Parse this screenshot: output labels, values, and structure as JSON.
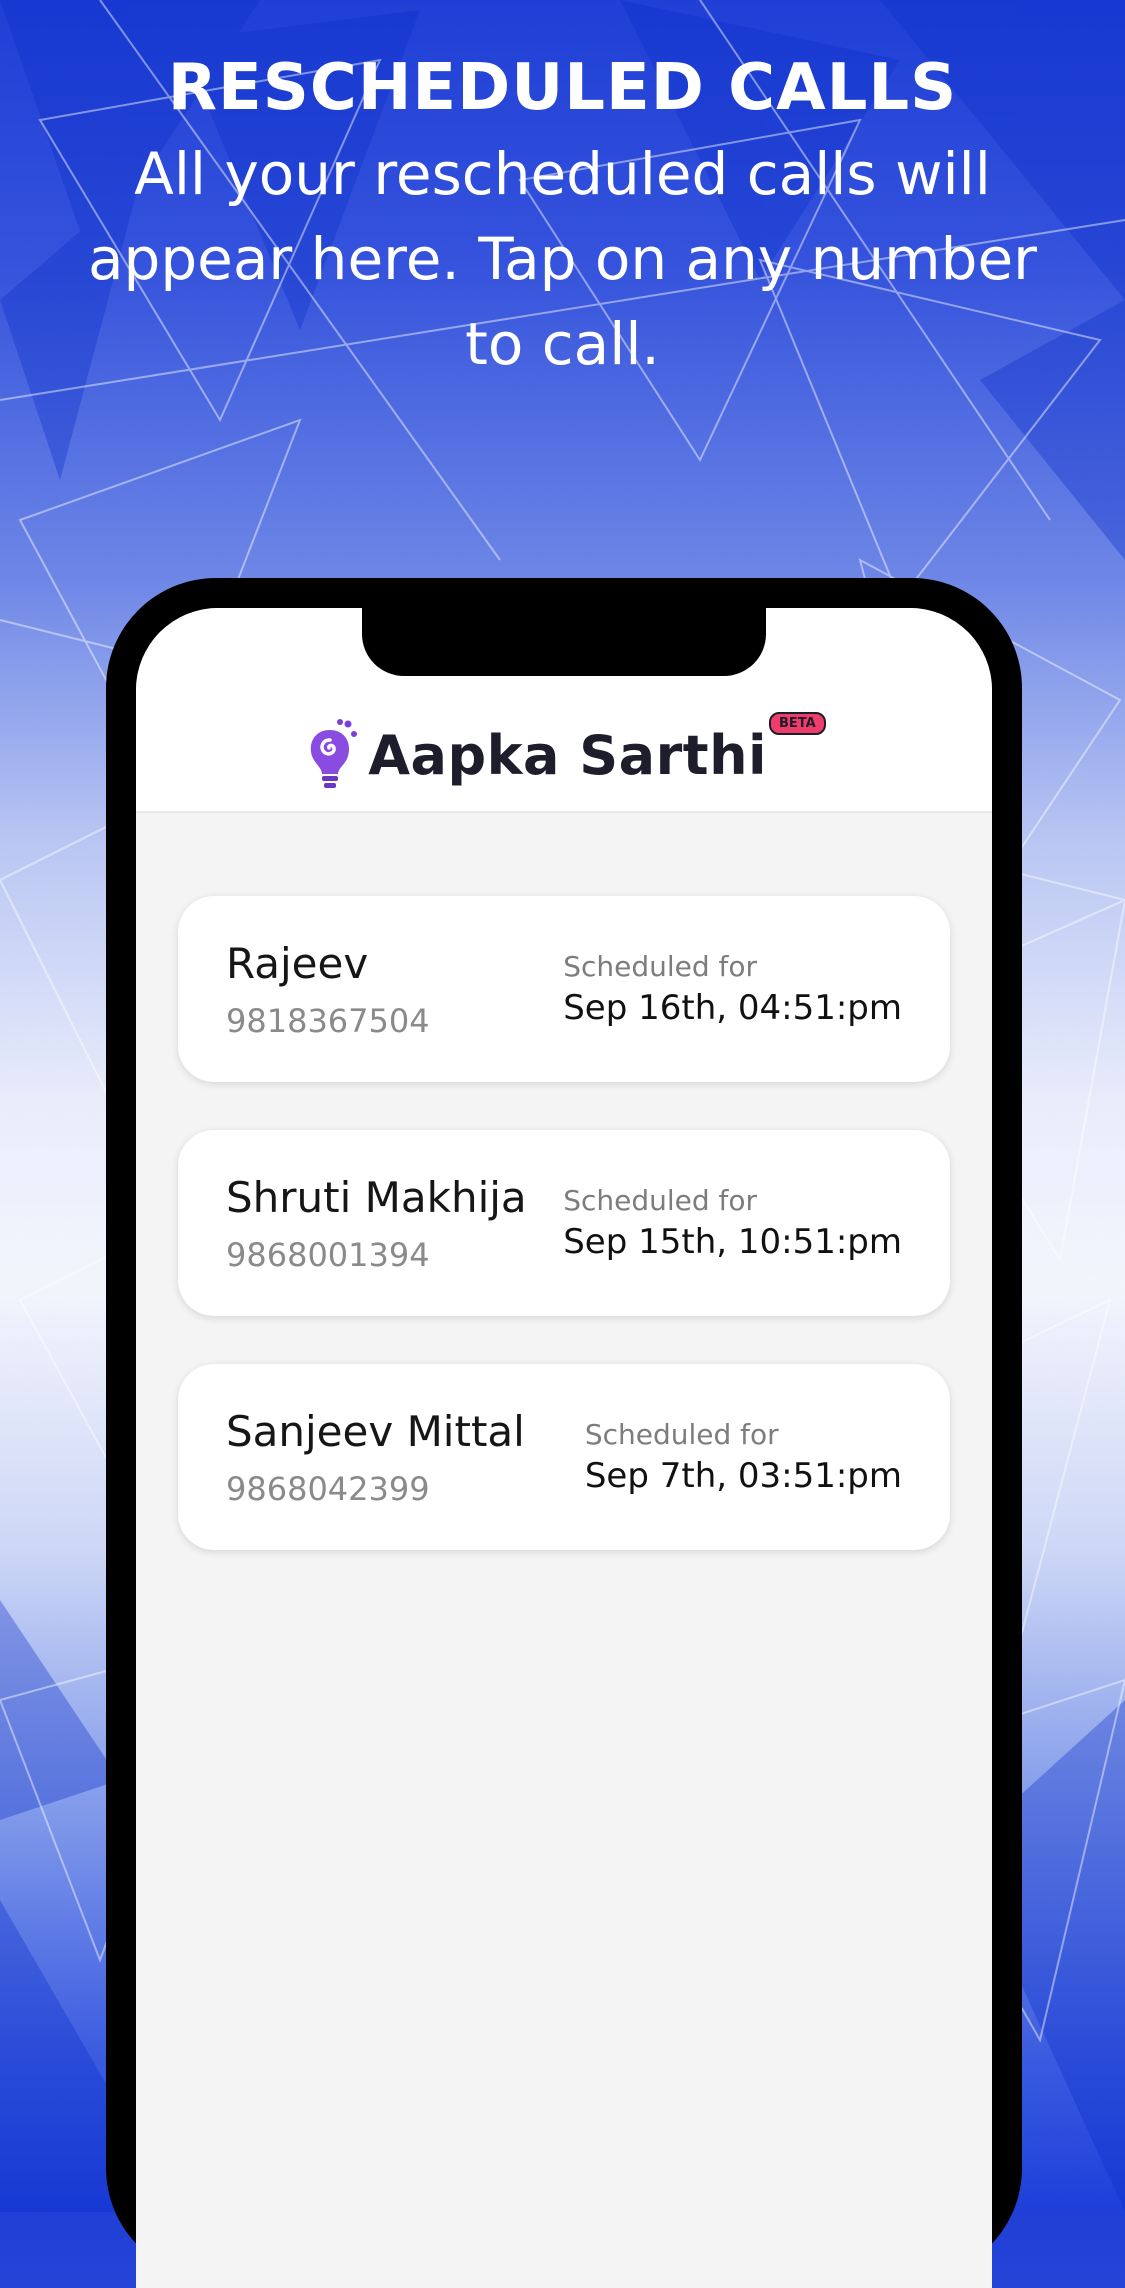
{
  "promo": {
    "title": "RESCHEDULED CALLS",
    "subtitle": "All your rescheduled calls will appear here. Tap on any number to call."
  },
  "app": {
    "brand_name": "Aapka Sarthi",
    "badge": "BETA",
    "logo_icon": "swirl-bulb-logo-icon"
  },
  "calls": [
    {
      "name": "Rajeev",
      "phone": "9818367504",
      "scheduled_label": "Scheduled for",
      "scheduled_time": "Sep 16th, 04:51:pm"
    },
    {
      "name": "Shruti Makhija",
      "phone": "9868001394",
      "scheduled_label": "Scheduled for",
      "scheduled_time": "Sep 15th, 10:51:pm"
    },
    {
      "name": "Sanjeev Mittal",
      "phone": "9868042399",
      "scheduled_label": "Scheduled for",
      "scheduled_time": "Sep 7th, 03:51:pm"
    }
  ],
  "colors": {
    "background_blue": "#1f3fd6",
    "phone_frame": "#000000",
    "screen_bg": "#f4f4f4",
    "card_bg": "#ffffff",
    "beta_badge": "#ef3d6b",
    "logo_purple": "#7b3fd6"
  }
}
